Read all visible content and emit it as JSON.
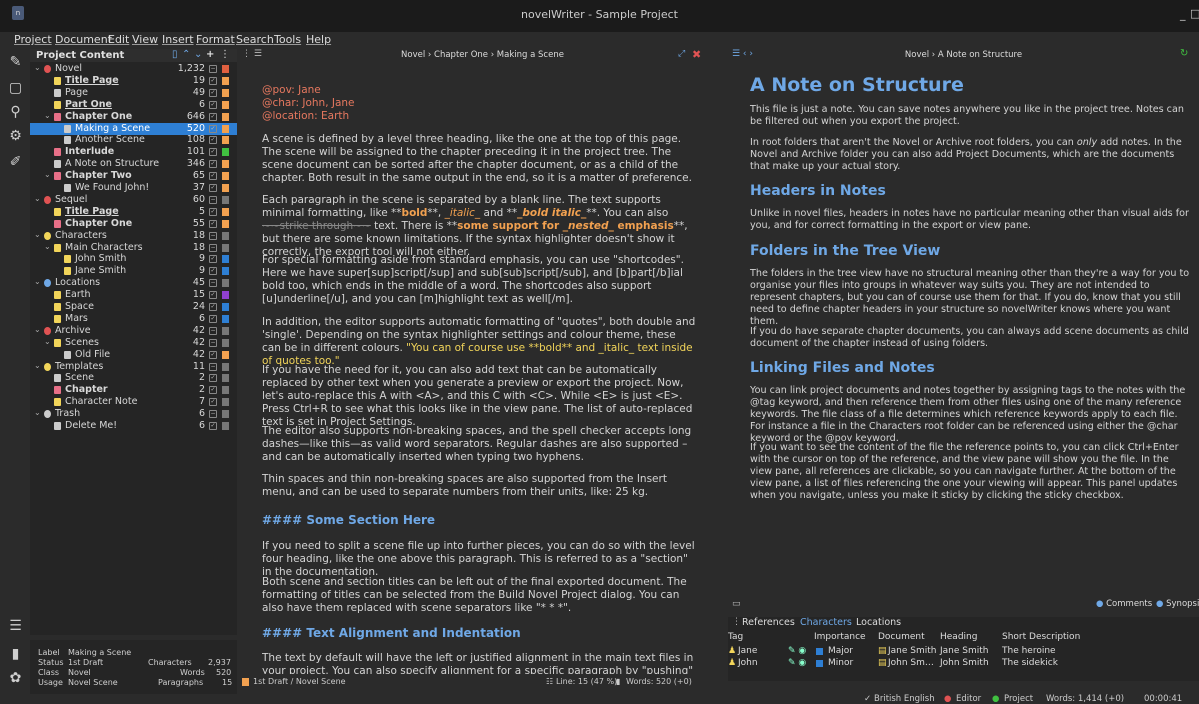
{
  "window": {
    "title": "novelWriter - Sample Project",
    "logo": "n"
  },
  "menu": [
    "Project",
    "Document",
    "Edit",
    "View",
    "Insert",
    "Format",
    "Search",
    "Tools",
    "Help"
  ],
  "sidebar_icons": [
    "new-document-icon",
    "project-tree-icon",
    "search-icon",
    "build-icon",
    "edit-icon",
    "outline-icon",
    "stats-icon",
    "settings-icon"
  ],
  "tree": {
    "header": "Project Content",
    "rows": [
      {
        "name": "Novel",
        "count": "1,232",
        "level": 0,
        "kind": "root",
        "color": "#e05353",
        "status": "#e06040",
        "bold": false
      },
      {
        "name": "Title Page",
        "count": "19",
        "level": 1,
        "kind": "title",
        "color": "#f2d55a",
        "status": "#f2a150",
        "bold": true,
        "underline": true
      },
      {
        "name": "Page",
        "count": "49",
        "level": 1,
        "kind": "page",
        "color": "#cccccc",
        "status": "#f2a150",
        "bold": false
      },
      {
        "name": "Part One",
        "count": "6",
        "level": 1,
        "kind": "part",
        "color": "#f2d55a",
        "status": "#f2a150",
        "bold": true,
        "underline": true
      },
      {
        "name": "Chapter One",
        "count": "646",
        "level": 1,
        "kind": "chapter",
        "color": "#e87088",
        "status": "#f2a150",
        "bold": true
      },
      {
        "name": "Making a Scene",
        "count": "520",
        "level": 2,
        "kind": "scene",
        "color": "#cccccc",
        "status": "#f2a150",
        "bold": false,
        "selected": true
      },
      {
        "name": "Another Scene",
        "count": "108",
        "level": 2,
        "kind": "scene",
        "color": "#cccccc",
        "status": "#f2a150",
        "bold": false
      },
      {
        "name": "Interlude",
        "count": "101",
        "level": 1,
        "kind": "chapter",
        "color": "#e87088",
        "status": "#40c040",
        "bold": true
      },
      {
        "name": "A Note on Structure",
        "count": "346",
        "level": 1,
        "kind": "note",
        "color": "#cccccc",
        "status": "#f2a150",
        "bold": false
      },
      {
        "name": "Chapter Two",
        "count": "65",
        "level": 1,
        "kind": "chapter",
        "color": "#e87088",
        "status": "#f2a150",
        "bold": true
      },
      {
        "name": "We Found John!",
        "count": "37",
        "level": 2,
        "kind": "scene",
        "color": "#cccccc",
        "status": "#f2a150",
        "bold": false
      },
      {
        "name": "Sequel",
        "count": "60",
        "level": 0,
        "kind": "root",
        "color": "#e05353",
        "status": "#777777",
        "bold": false
      },
      {
        "name": "Title Page",
        "count": "5",
        "level": 1,
        "kind": "title",
        "color": "#f2d55a",
        "status": "#f2a150",
        "bold": true,
        "underline": true
      },
      {
        "name": "Chapter One",
        "count": "55",
        "level": 1,
        "kind": "chapter",
        "color": "#e87088",
        "status": "#f2a150",
        "bold": true
      },
      {
        "name": "Characters",
        "count": "18",
        "level": 0,
        "kind": "root",
        "color": "#f2d55a",
        "status": "#777777",
        "bold": false
      },
      {
        "name": "Main Characters",
        "count": "18",
        "level": 1,
        "kind": "folder",
        "color": "#f2d55a",
        "status": "#777777",
        "bold": false
      },
      {
        "name": "John Smith",
        "count": "9",
        "level": 2,
        "kind": "note",
        "color": "#f2d55a",
        "status": "#2e7fd4",
        "bold": false
      },
      {
        "name": "Jane Smith",
        "count": "9",
        "level": 2,
        "kind": "note",
        "color": "#f2d55a",
        "status": "#2e7fd4",
        "bold": false
      },
      {
        "name": "Locations",
        "count": "45",
        "level": 0,
        "kind": "root",
        "color": "#6fa8e6",
        "status": "#777777",
        "bold": false
      },
      {
        "name": "Earth",
        "count": "15",
        "level": 1,
        "kind": "note",
        "color": "#f2d55a",
        "status": "#9040d0",
        "bold": false
      },
      {
        "name": "Space",
        "count": "24",
        "level": 1,
        "kind": "note",
        "color": "#f2d55a",
        "status": "#2e7fd4",
        "bold": false
      },
      {
        "name": "Mars",
        "count": "6",
        "level": 1,
        "kind": "note",
        "color": "#f2d55a",
        "status": "#2e7fd4",
        "bold": false
      },
      {
        "name": "Archive",
        "count": "42",
        "level": 0,
        "kind": "root",
        "color": "#e05353",
        "status": "#777777",
        "bold": false
      },
      {
        "name": "Scenes",
        "count": "42",
        "level": 1,
        "kind": "folder",
        "color": "#f2d55a",
        "status": "#777777",
        "bold": false
      },
      {
        "name": "Old File",
        "count": "42",
        "level": 2,
        "kind": "scene",
        "color": "#cccccc",
        "status": "#f2a150",
        "bold": false
      },
      {
        "name": "Templates",
        "count": "11",
        "level": 0,
        "kind": "root",
        "color": "#f2d55a",
        "status": "#777777",
        "bold": false
      },
      {
        "name": "Scene",
        "count": "2",
        "level": 1,
        "kind": "scene",
        "color": "#cccccc",
        "status": "#777777",
        "bold": false
      },
      {
        "name": "Chapter",
        "count": "2",
        "level": 1,
        "kind": "chapter",
        "color": "#e87088",
        "status": "#777777",
        "bold": true
      },
      {
        "name": "Character Note",
        "count": "7",
        "level": 1,
        "kind": "note",
        "color": "#f2d55a",
        "status": "#777777",
        "bold": false
      },
      {
        "name": "Trash",
        "count": "6",
        "level": 0,
        "kind": "root",
        "color": "#cccccc",
        "status": "#777777",
        "bold": false
      },
      {
        "name": "Delete Me!",
        "count": "6",
        "level": 1,
        "kind": "scene",
        "color": "#cccccc",
        "status": "#777777",
        "bold": false
      }
    ]
  },
  "details": {
    "label_key": "Label",
    "label_val": "Making a Scene",
    "status_key": "Status",
    "status_val": "1st Draft",
    "class_key": "Class",
    "class_val": "Novel",
    "usage_key": "Usage",
    "usage_val": "Novel Scene",
    "chars_key": "Characters",
    "chars_val": "2,937",
    "words_key": "Words",
    "words_val": "520",
    "paras_key": "Paragraphs",
    "paras_val": "15"
  },
  "editor": {
    "crumb": "Novel › Chapter One › Making a Scene",
    "meta": [
      "@pov: Jane",
      "@char: John, Jane",
      "@location: Earth"
    ],
    "p1": "A scene is defined by a level three heading, like the one at the top of this page. The scene will be assigned to the chapter preceding it in the project tree. The scene document can be sorted after the chapter document, or as a child of the chapter. Both result in the same output in the end, so it is a matter of preference.",
    "p2a": "Each paragraph in the scene is separated by a blank line. The text supports minimal formatting, like **",
    "p2b": "bold",
    "p2c": "**, ",
    "p2d": "_italic_",
    "p2e": " and **",
    "p2f": "_bold italic_",
    "p2g": "**. You can also ",
    "p2h": "~~strike through~~",
    "p2i": " text. There is **",
    "p2j": "some support for ",
    "p2k": "_nested_",
    "p2l": " emphasis",
    "p2m": "**, but there are some known limitations. If the syntax highlighter doesn't show it correctly, the export tool will not either.",
    "p3": "For special formatting aside from standard emphasis, you can use \"shortcodes\". Here we have super[sup]script[/sup] and sub[sub]script[/sub], and [b]part[/b]ial bold too, which ends in the middle of a word. The shortcodes also support [u]underline[/u], and you can [m]highlight text as well[/m].",
    "p4a": "In addition, the editor supports automatic formatting of \"quotes\", both double and 'single'. Depending on the syntax highlighter settings and colour theme, these can be in different colours.",
    "p4b": "\"You can of course use **bold** and _italic_ text inside of quotes too.\"",
    "p5": "If you have the need for it, you can also add text that can be automatically replaced by other text when you generate a preview or export the project. Now, let's auto-replace this A with <A>, and this C with <C>. While <E> is just <E>. Press Ctrl+R to see what this looks like in the view pane. The list of auto-replaced text is set in Project Settings.",
    "p6": "The editor also supports non-breaking spaces, and the spell checker accepts long dashes—like this—as valid word separators. Regular dashes are also supported – and can be automatically inserted when typing two hyphens.",
    "p7": "Thin spaces and thin non-breaking spaces are also supported from the Insert menu, and can be used to separate numbers from their units, like: 25 kg.",
    "h1": "#### Some Section Here",
    "p8": "If you need to split a scene file up into further pieces, you can do so with the level four heading, like the one above this paragraph. This is referred to as a \"section\" in the documentation.",
    "p9": "Both scene and section titles can be left out of the final exported document. The formatting of titles can be selected from the Build Novel Project dialog. You can also have them replaced with scene separators like \"* * *\".",
    "h2": "#### Text Alignment and Indentation",
    "p10": "The text by default will have the left or justified alignment in the main text files in your project. You can also specify alignment for a specific paragraph by \"pushing\" it away from an edge with a set of",
    "foot_status": "1st Draft / Novel Scene",
    "foot_line": "Line: 15 (47 %)",
    "foot_words": "Words: 520 (+0)"
  },
  "viewer": {
    "crumb": "Novel › A Note on Structure",
    "h1": "A Note on Structure",
    "p1": "This file is just a note. You can save notes anywhere you like in the project tree. Notes can be filtered out when you export the project.",
    "p2a": "In root folders that aren't the Novel or Archive root folders, you can ",
    "p2b": "only",
    "p2c": " add notes. In the Novel and Archive folder you can also add Project Documents, which are the documents that make up your actual story.",
    "h2": "Headers in Notes",
    "p3": "Unlike in novel files, headers in notes have no particular meaning other than visual aids for you, and for correct formatting in the export or view pane.",
    "h3": "Folders in the Tree View",
    "p4": "The folders in the tree view have no structural meaning other than they're a way for you to organise your files into groups in whatever way suits you. They are not intended to represent chapters, but you can of course use them for that. If you do, know that you still need to define chapter headers in your structure so novelWriter knows where you want them.",
    "p5": "If you do have separate chapter documents, you can always add scene documents as child document of the chapter instead of using folders.",
    "h4": "Linking Files and Notes",
    "p6": "You can link project documents and notes together by assigning tags to the notes with the @tag keyword, and then reference them from other files using one of the many reference keywords. The file class of a file determines which reference keywords apply to each file. For instance a file in the Characters root folder can be referenced using either the @char keyword or the @pov keyword.",
    "p7": "If you want to see the content of the file the reference points to, you can click Ctrl+Enter with the cursor on top of the reference, and the view pane will show you the file. In the view pane, all references are clickable, so you can navigate further. At the bottom of the view pane, a list of files referencing the one your viewing will appear. This panel updates when you navigate, unless you make it sticky by clicking the sticky checkbox.",
    "comments": "Comments",
    "synopsis": "Synopsis"
  },
  "refs": {
    "tabs": [
      "References",
      "Characters",
      "Locations"
    ],
    "active_tab": "Characters",
    "cols": [
      "Tag",
      "Importance",
      "Document",
      "Heading",
      "Short Description"
    ],
    "rows": [
      {
        "tag": "Jane",
        "importance": "Major",
        "imp_color": "#2e7fd4",
        "document": "Jane Smith",
        "heading": "Jane Smith",
        "desc": "The heroine"
      },
      {
        "tag": "John",
        "importance": "Minor",
        "imp_color": "#2e7fd4",
        "document": "John Sm…",
        "heading": "John Smith",
        "desc": "The sidekick"
      }
    ]
  },
  "status": {
    "lang": "British English",
    "editor": "Editor",
    "project": "Project",
    "words": "Words: 1,414 (+0)",
    "time": "00:00:41"
  }
}
